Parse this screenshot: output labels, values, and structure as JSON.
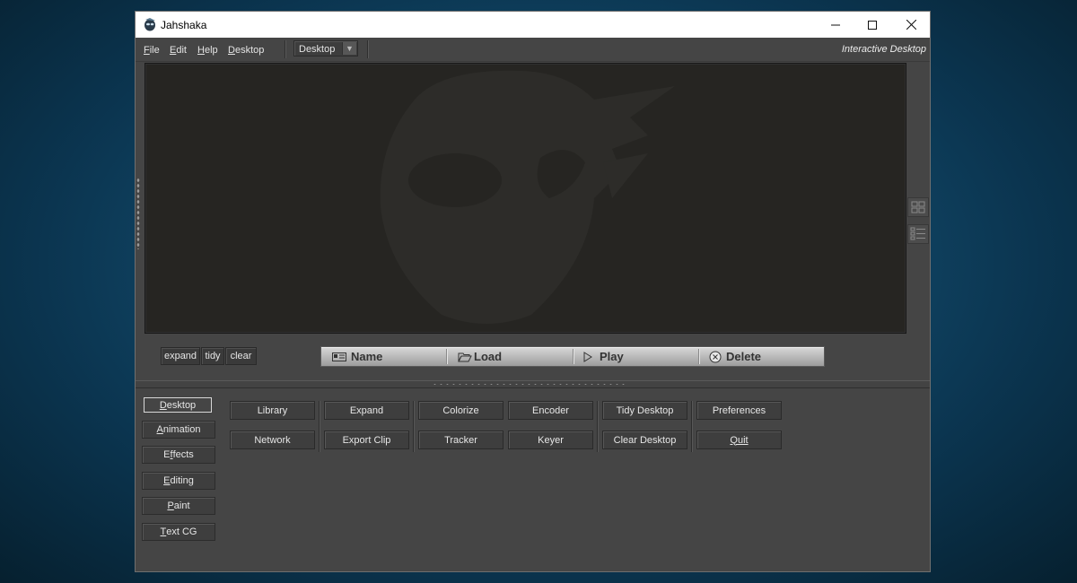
{
  "window": {
    "title": "Jahshaka"
  },
  "menu": {
    "items": [
      {
        "label": "File",
        "key": "F",
        "rest": "ile"
      },
      {
        "label": "Edit",
        "key": "E",
        "rest": "dit"
      },
      {
        "label": "Help",
        "key": "H",
        "rest": "elp"
      },
      {
        "label": "Desktop",
        "key": "D",
        "rest": "esktop"
      }
    ],
    "mode_select_value": "Desktop",
    "mode_label": "Interactive Desktop"
  },
  "desktop_controls": {
    "expand": "expand",
    "tidy": "tidy",
    "clear": "clear"
  },
  "toolstrip": {
    "name": "Name",
    "load": "Load",
    "play": "Play",
    "delete": "Delete"
  },
  "categories": [
    {
      "label": "Desktop",
      "key": "D",
      "rest": "esktop",
      "active": true
    },
    {
      "label": "Animation",
      "key": "A",
      "rest": "nimation"
    },
    {
      "label": "Effects",
      "key": "f",
      "pre": "E",
      "rest": "fects"
    },
    {
      "label": "Editing",
      "key": "E",
      "rest": "diting"
    },
    {
      "label": "Paint",
      "key": "P",
      "rest": "aint"
    },
    {
      "label": "Text CG",
      "key": "T",
      "rest": "ext CG"
    }
  ],
  "actions": {
    "library": "Library",
    "network": "Network",
    "expand": "Expand",
    "export_clip": "Export Clip",
    "colorize": "Colorize",
    "tracker": "Tracker",
    "encoder": "Encoder",
    "keyer": "Keyer",
    "tidy_desktop": "Tidy Desktop",
    "clear_desktop": "Clear Desktop",
    "preferences": "Preferences",
    "quit": "Quit"
  },
  "colors": {
    "canvas": "#262522",
    "panel": "#454545",
    "watermark": "#2d2c29"
  }
}
